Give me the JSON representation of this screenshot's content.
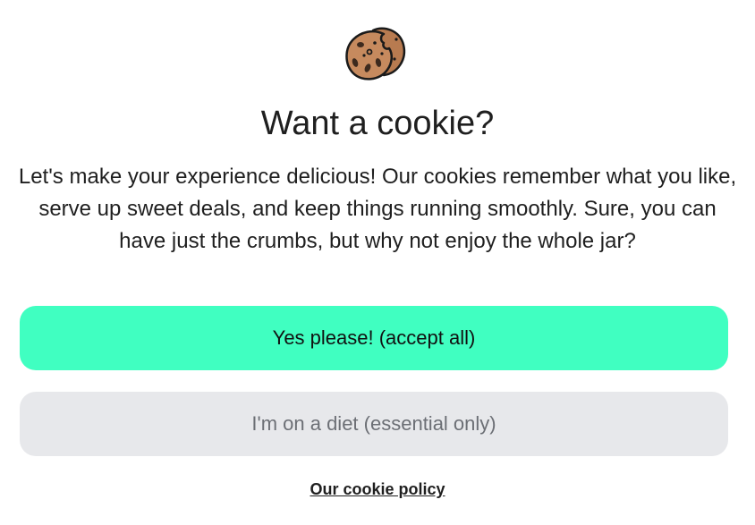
{
  "dialog": {
    "title": "Want a cookie?",
    "description": "Let's make your experience delicious! Our cookies remember what you like, serve up sweet deals, and keep things running smoothly. Sure, you can have just the crumbs, but why not enjoy the whole jar?",
    "accept_label": "Yes please! (accept all)",
    "essential_label": "I'm on a diet (essential only)",
    "policy_link": "Our cookie policy",
    "icon": "cookie-icon"
  },
  "colors": {
    "accept_bg": "#40ffc1",
    "essential_bg": "#e7e8eb",
    "essential_text": "#6c6f75",
    "cookie_fill": "#c68a5e",
    "cookie_outline": "#1a1a1a"
  }
}
